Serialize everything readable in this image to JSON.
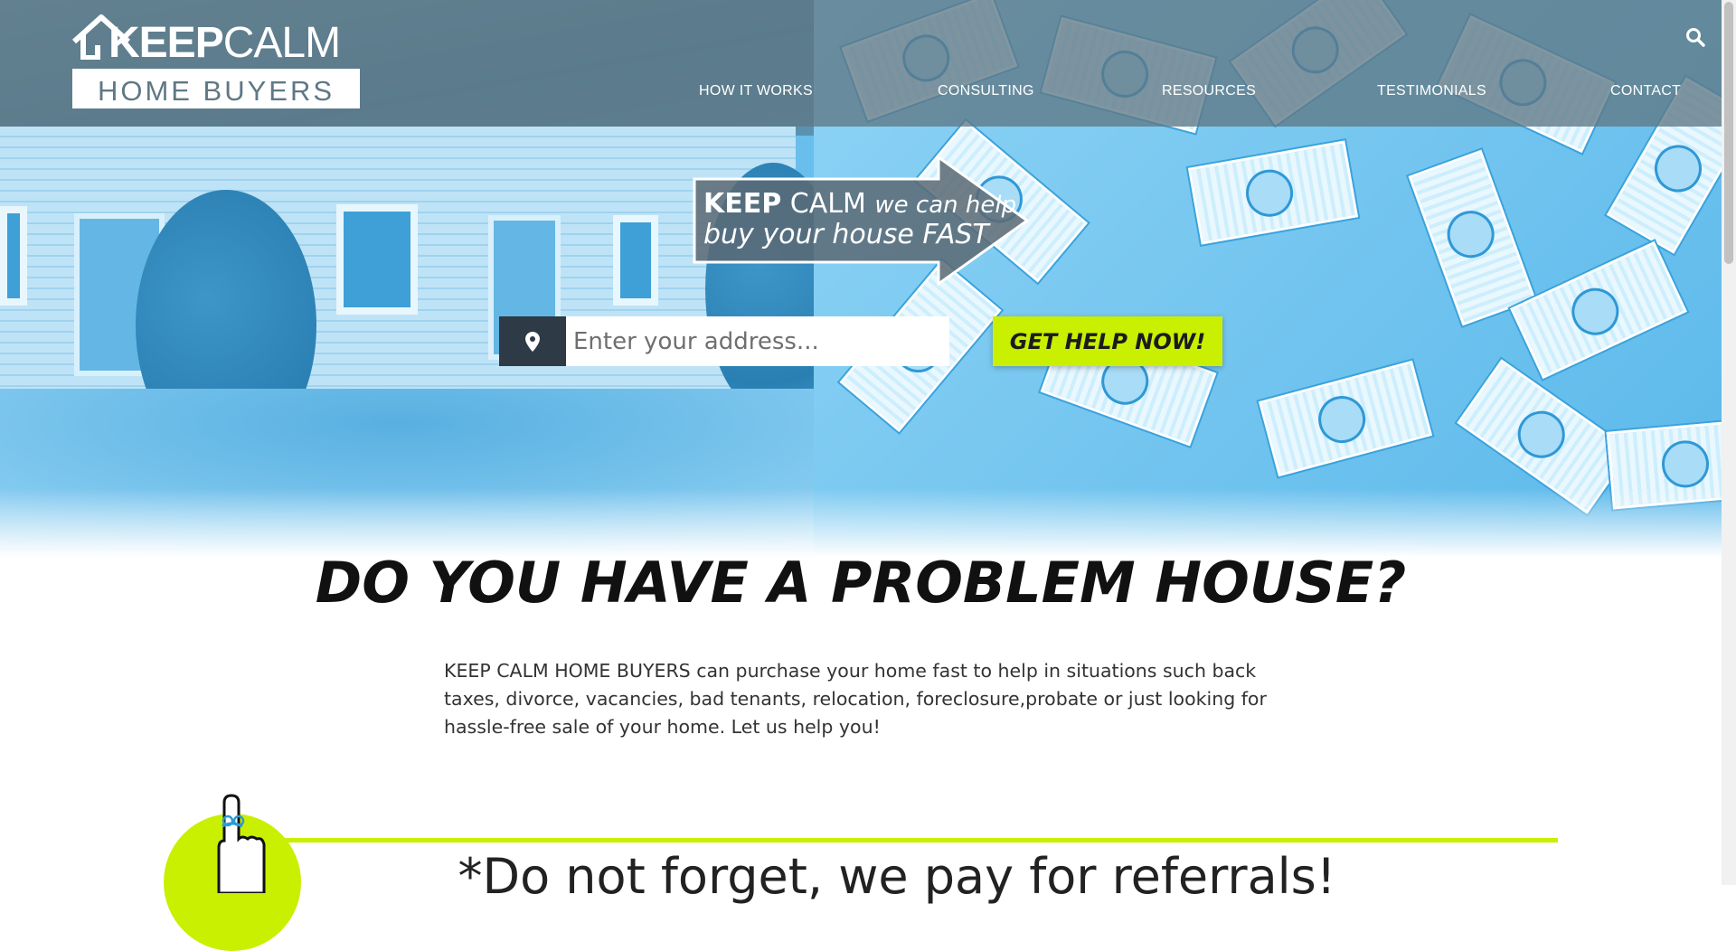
{
  "header": {
    "logo": {
      "top_bold": "KEEP",
      "top_light": "CALM",
      "bottom": "HOME BUYERS"
    },
    "nav": [
      {
        "label": "HOW IT WORKS"
      },
      {
        "label": "CONSULTING"
      },
      {
        "label": "RESOURCES"
      },
      {
        "label": "TESTIMONIALS"
      },
      {
        "label": "CONTACT"
      }
    ],
    "search_icon": "search-icon"
  },
  "hero": {
    "tagline": {
      "bold": "KEEP",
      "light": "CALM",
      "italic": "we can help",
      "line2": "buy your house FAST"
    },
    "search": {
      "icon": "map-pin-icon",
      "placeholder": "Enter your address...",
      "button_label": "GET HELP NOW!"
    }
  },
  "main": {
    "title": "DO YOU HAVE A PROBLEM HOUSE?",
    "intro": "KEEP CALM HOME BUYERS can purchase your home fast to help in situations such back taxes, divorce, vacancies, bad tenants, relocation, foreclosure,probate or just looking for hassle-free sale of your home. Let us help you!",
    "referral": "*Do not forget, we pay for referrals!"
  },
  "colors": {
    "accent": "#c8f000",
    "header_overlay": "#5f7885",
    "hero_blue": "#5fbaeb",
    "pin_box": "#2e3a45"
  }
}
